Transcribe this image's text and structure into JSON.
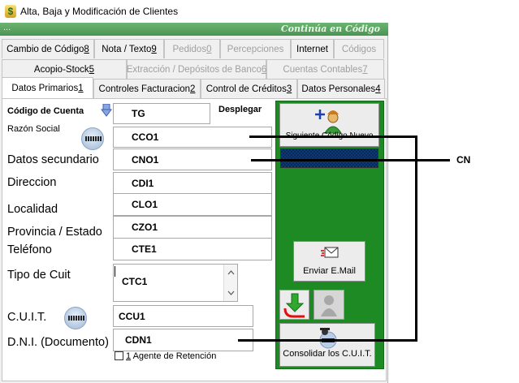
{
  "window": {
    "title": "Alta, Baja y Modificación de Clientes",
    "subtitle_dots": "...",
    "continua_text": "Continúa en Código"
  },
  "tabs_row1": [
    {
      "label": "Cambio de Código ",
      "key": "8",
      "disabled": false
    },
    {
      "label": "Nota / Texto ",
      "key": "9",
      "disabled": false
    },
    {
      "label": "Pedidos ",
      "key": "0",
      "disabled": true
    },
    {
      "label": "Percepciones",
      "key": "",
      "disabled": true
    },
    {
      "label": "Internet",
      "key": "",
      "disabled": false
    },
    {
      "label": "Códigos",
      "key": "",
      "disabled": true
    }
  ],
  "tabs_row2": [
    {
      "label": "Acopio-Stock ",
      "key": "5",
      "disabled": false
    },
    {
      "label": "Extracción / Depósitos de Banco ",
      "key": "6",
      "disabled": true
    },
    {
      "label": "Cuentas Contables ",
      "key": "7",
      "disabled": true
    }
  ],
  "tabs_row3": [
    {
      "label": "Datos Primarios ",
      "key": "1",
      "active": true
    },
    {
      "label": "Controles Facturacion ",
      "key": "2",
      "active": false
    },
    {
      "label": "Control de Créditos ",
      "key": "3",
      "active": false
    },
    {
      "label": "Datos Personales ",
      "key": "4",
      "active": false
    }
  ],
  "form": {
    "codigo_label": "Código de Cuenta",
    "desplegar_label": "Desplegar",
    "razon_label": "Razón Social",
    "datos_sec_label": "Datos secundario",
    "direccion_label": "Direccion",
    "localidad_label": "Localidad",
    "provincia_label": "Provincia / Estado",
    "telefono_label": "Teléfono",
    "tipo_cuit_label": "Tipo de Cuit",
    "cuit_label": "C.U.I.T.",
    "dni_label": "D.N.I. (Documento)",
    "agente_key": "1",
    "agente_label": " Agente de Retención",
    "values": {
      "codigo": "TG",
      "razon": "CCO1",
      "datos_sec": "CNO1",
      "direccion": "CDI1",
      "localidad": "CLO1",
      "provincia": "CZO1",
      "telefono": "CTE1",
      "tipo_cuit": "CTC1",
      "cuit": "CCU1",
      "dni": "CDN1"
    }
  },
  "side": {
    "siguiente_label": "Siguiente Código Nuevo",
    "enviar_label": "Enviar E.Mail",
    "consolidar_label": "Consolidar los C.U.I.T."
  },
  "annotation": {
    "cn_label": "CN"
  },
  "colors": {
    "green_panel": "#1e8a23",
    "title_green": "#4a9451"
  }
}
